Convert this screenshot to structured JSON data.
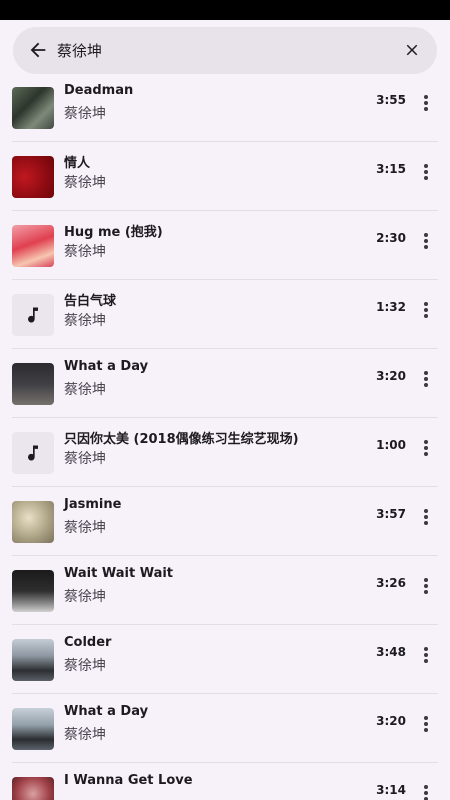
{
  "search": {
    "query": "蔡徐坤"
  },
  "songs": [
    {
      "title": "Deadman",
      "artist": "蔡徐坤",
      "duration": "3:55",
      "art": "image"
    },
    {
      "title": "情人",
      "artist": "蔡徐坤",
      "duration": "3:15",
      "art": "image"
    },
    {
      "title": "Hug me (抱我)",
      "artist": "蔡徐坤",
      "duration": "2:30",
      "art": "image"
    },
    {
      "title": "告白气球",
      "artist": "蔡徐坤",
      "duration": "1:32",
      "art": "music-note-icon"
    },
    {
      "title": "What a Day",
      "artist": "蔡徐坤",
      "duration": "3:20",
      "art": "image"
    },
    {
      "title": "只因你太美 (2018偶像练习生综艺现场)",
      "artist": "蔡徐坤",
      "duration": "1:00",
      "art": "music-note-icon"
    },
    {
      "title": "Jasmine",
      "artist": "蔡徐坤",
      "duration": "3:57",
      "art": "image"
    },
    {
      "title": "Wait Wait Wait",
      "artist": "蔡徐坤",
      "duration": "3:26",
      "art": "image"
    },
    {
      "title": "Colder",
      "artist": "蔡徐坤",
      "duration": "3:48",
      "art": "image"
    },
    {
      "title": "What a Day",
      "artist": "蔡徐坤",
      "duration": "3:20",
      "art": "image"
    },
    {
      "title": "I Wanna Get Love",
      "artist": "",
      "duration": "3:14",
      "art": "image"
    }
  ]
}
